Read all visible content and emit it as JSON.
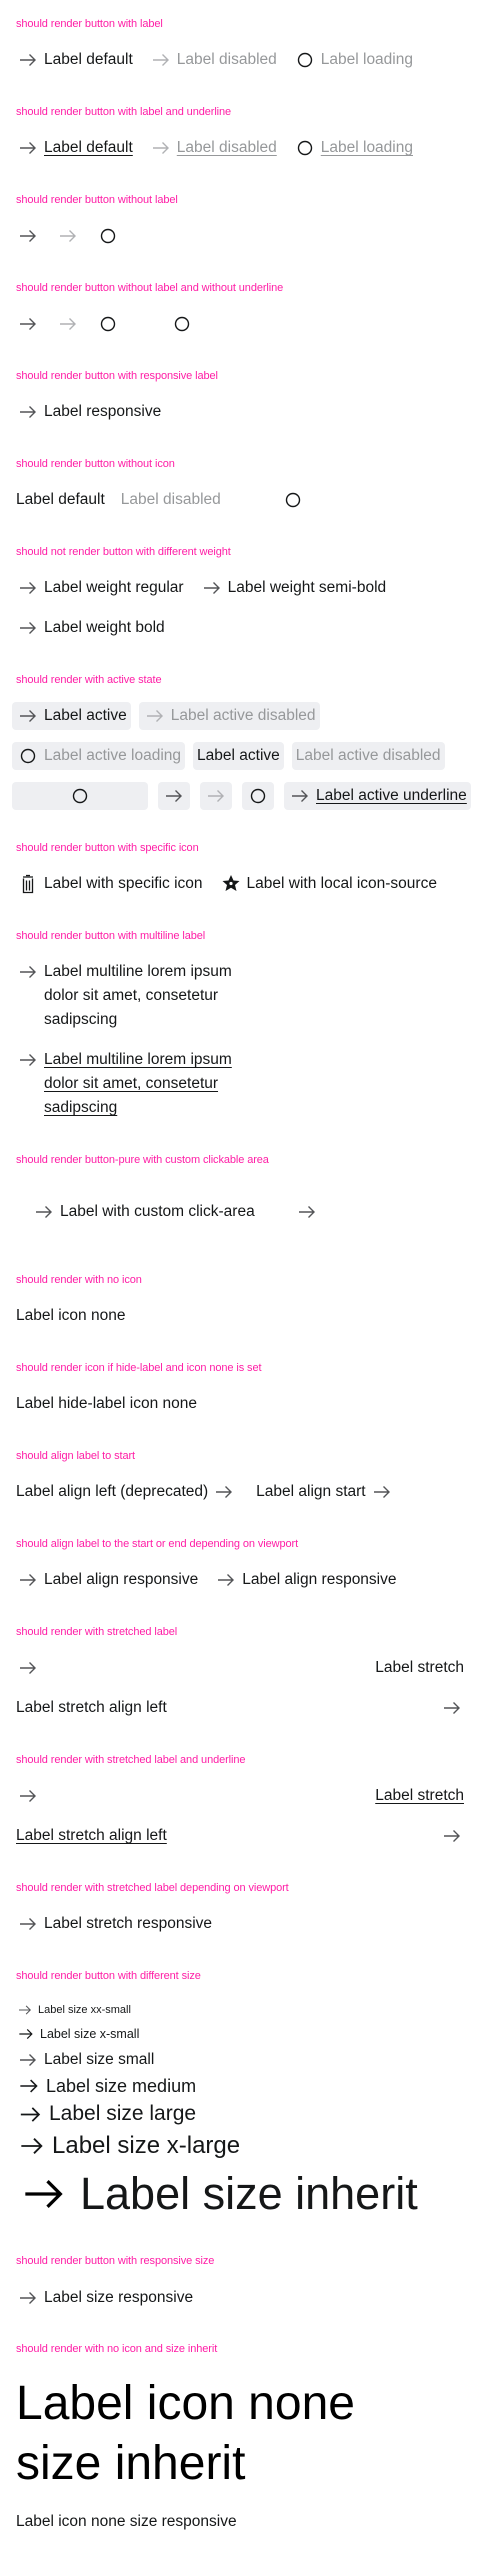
{
  "colors": {
    "heading": "#ff1ea6",
    "text": "#151718",
    "disabled": "#96989a",
    "active_bg": "#eeeff2"
  },
  "icons": {
    "arrow": "arrow-right-icon",
    "spinner": "spinner-icon",
    "trash": "delete-icon",
    "local": "local-icon"
  },
  "s1": {
    "title": "should render button with label",
    "b": [
      "Label default",
      "Label disabled",
      "Label loading"
    ]
  },
  "s2": {
    "title": "should render button with label and underline",
    "b": [
      "Label default",
      "Label disabled",
      "Label loading"
    ]
  },
  "s3": {
    "title": "should render button without label"
  },
  "s4": {
    "title": "should render button without label and without underline"
  },
  "s5": {
    "title": "should render button with responsive label",
    "b": [
      "Label responsive"
    ]
  },
  "s6": {
    "title": "should render button without icon",
    "b": [
      "Label default",
      "Label disabled"
    ]
  },
  "s7": {
    "title": "should not render button with different weight",
    "b": [
      "Label weight regular",
      "Label weight semi-bold",
      "Label weight bold"
    ]
  },
  "s8": {
    "title": "should render with active state",
    "b": [
      "Label active",
      "Label active disabled",
      "Label active loading",
      "Label active",
      "Label active disabled",
      "Label active underline"
    ]
  },
  "s9": {
    "title": "should render button with specific icon",
    "b": [
      "Label with specific icon",
      "Label with local icon-source"
    ]
  },
  "s10": {
    "title": "should render button with multiline label",
    "b": [
      "Label multiline lorem ipsum dolor sit amet, consetetur sadipscing",
      "Label multiline lorem ipsum dolor sit amet, consetetur sadipscing"
    ]
  },
  "s11": {
    "title": "should render button-pure with custom clickable area",
    "b": [
      "Label with custom click-area"
    ]
  },
  "s12": {
    "title": "should render with no icon",
    "b": [
      "Label icon none"
    ]
  },
  "s13": {
    "title": "should render icon if hide-label and icon none is set",
    "b": [
      "Label hide-label icon none"
    ]
  },
  "s14": {
    "title": "should align label to start",
    "b": [
      "Label align left (deprecated)",
      "Label align start"
    ]
  },
  "s15": {
    "title": "should align label to the start or end depending on viewport",
    "b": [
      "Label align responsive",
      "Label align responsive"
    ]
  },
  "s16": {
    "title": "should render with stretched label",
    "b": [
      "Label stretch",
      "Label stretch align left"
    ]
  },
  "s17": {
    "title": "should render with stretched label and underline",
    "b": [
      "Label stretch",
      "Label stretch align left"
    ]
  },
  "s18": {
    "title": "should render with stretched label depending on viewport",
    "b": [
      "Label stretch responsive"
    ]
  },
  "s19": {
    "title": "should render button with different size",
    "b": [
      "Label size xx-small",
      "Label size x-small",
      "Label size small",
      "Label size medium",
      "Label size large",
      "Label size x-large",
      "Label size inherit"
    ]
  },
  "s20": {
    "title": "should render button with responsive size",
    "b": [
      "Label size responsive"
    ]
  },
  "s21": {
    "title": "should render with no icon and size inherit",
    "b": [
      "Label icon none size inherit",
      "Label icon none size responsive"
    ]
  }
}
